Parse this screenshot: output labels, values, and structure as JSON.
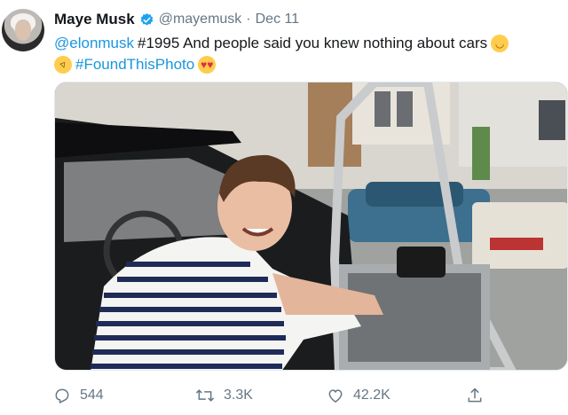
{
  "user": {
    "name": "Maye Musk",
    "handle": "@mayemusk",
    "separator": "·",
    "date": "Dec 11",
    "verified": true
  },
  "tweet": {
    "mention": "@elonmusk",
    "line1_text": "#1995 And people said you knew nothing about cars",
    "hashtag": "#FoundThisPhoto",
    "emojis": [
      "smirking-face",
      "rolling-on-floor-laughing",
      "smiling-face-with-heart-eyes"
    ]
  },
  "photo": {
    "subject": "young man in striped shirt leaning out of a car with its door panel removed"
  },
  "actions": {
    "replies": "544",
    "retweets": "3.3K",
    "likes": "42.2K"
  },
  "colors": {
    "link": "#1b95e0",
    "meta": "#657786",
    "verified": "#1da1f2"
  }
}
